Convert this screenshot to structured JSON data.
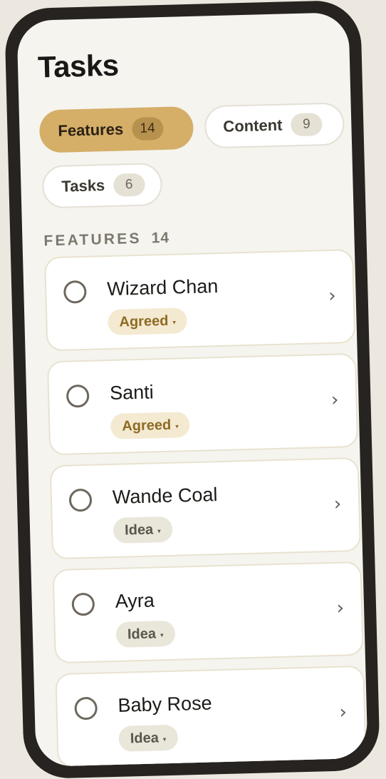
{
  "header": {
    "title": "Tasks"
  },
  "filters": [
    {
      "label": "Features",
      "count": "14",
      "active": true
    },
    {
      "label": "Content",
      "count": "9",
      "active": false
    },
    {
      "label": "Tasks",
      "count": "6",
      "active": false
    }
  ],
  "section": {
    "label": "FEATURES",
    "count": "14"
  },
  "items": [
    {
      "title": "Wizard Chan",
      "status": "Agreed",
      "caret": "▾",
      "chevron": "›"
    },
    {
      "title": "Santi",
      "status": "Agreed",
      "caret": "▾",
      "chevron": "›"
    },
    {
      "title": "Wande Coal",
      "status": "Idea",
      "caret": "▾",
      "chevron": "›"
    },
    {
      "title": "Ayra",
      "status": "Idea",
      "caret": "▾",
      "chevron": "›"
    },
    {
      "title": "Baby Rose",
      "status": "Idea",
      "caret": "▾",
      "chevron": "›"
    }
  ],
  "colors": {
    "accent": "#d5ae68",
    "agreed_text": "#8e6a23",
    "agreed_bg": "#f4ead2",
    "idea_bg": "#e9e6da",
    "frame": "#262320",
    "screen": "#f5f4ef"
  }
}
